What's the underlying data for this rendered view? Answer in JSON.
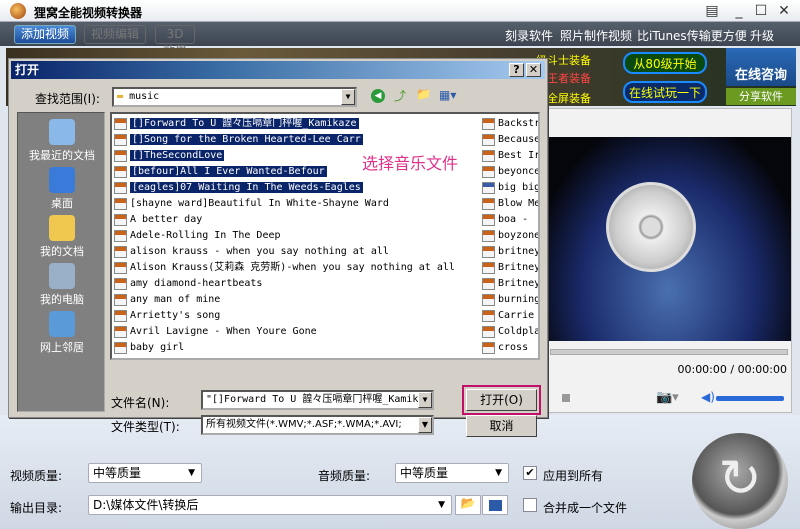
{
  "window": {
    "title": "狸窝全能视频转换器"
  },
  "toolbar": {
    "add_video": "添加视频",
    "edit_video": "视频编辑",
    "effect_3d": "3D效果",
    "links": [
      "刻录软件",
      "照片制作视频",
      "比iTunes传输更方便",
      "升级"
    ]
  },
  "banner": {
    "ads": [
      "级斗士装备",
      "级王者装备",
      "级全屏装备",
      "从80级开始",
      "在线试玩一下"
    ],
    "consult": "在线咨询",
    "share": "分享软件"
  },
  "player": {
    "time": "00:00:00 / 00:00:00",
    "volume_percent": 100
  },
  "dialog": {
    "title": "打开",
    "look_in_label": "查找范围(I):",
    "look_in_value": "music",
    "places": [
      "我最近的文档",
      "桌面",
      "我的文档",
      "我的电脑",
      "网上邻居"
    ],
    "annotation": "选择音乐文件",
    "files_left": [
      {
        "name": "[]Forward To U 韹々压嗝章冂枰喔_Kamikaze",
        "selected": true,
        "type": "mp3"
      },
      {
        "name": "[]Song for the Broken Hearted-Lee Carr",
        "selected": true,
        "type": "mp3"
      },
      {
        "name": "[]TheSecondLove",
        "selected": true,
        "type": "mp3"
      },
      {
        "name": "[befour]All I Ever Wanted-Befour",
        "selected": true,
        "type": "mp3"
      },
      {
        "name": "[eagles]07 Waiting In The Weeds-Eagles",
        "selected": true,
        "type": "mp3"
      },
      {
        "name": "[shayne ward]Beautiful In White-Shayne Ward",
        "selected": false,
        "type": "mp3"
      },
      {
        "name": "A better day",
        "selected": false,
        "type": "mp3"
      },
      {
        "name": "Adele-Rolling In The Deep",
        "selected": false,
        "type": "mp3"
      },
      {
        "name": "alison krauss - when you say nothing at all",
        "selected": false,
        "type": "mp3"
      },
      {
        "name": "Alison Krauss(艾莉森 克劳斯)-when you say nothing at all",
        "selected": false,
        "type": "mp3"
      },
      {
        "name": "amy diamond-heartbeats",
        "selected": false,
        "type": "mp3"
      },
      {
        "name": "any man of mine",
        "selected": false,
        "type": "mp3"
      },
      {
        "name": "Arrietty's song",
        "selected": false,
        "type": "mp3"
      },
      {
        "name": "Avril Lavigne - When Youre Gone",
        "selected": false,
        "type": "mp3"
      },
      {
        "name": "baby girl",
        "selected": false,
        "type": "mp3"
      }
    ],
    "files_right": [
      {
        "name": "Backstr",
        "type": "mp3"
      },
      {
        "name": "Because",
        "type": "mp3"
      },
      {
        "name": "Best Ir",
        "type": "mp3"
      },
      {
        "name": "beyonce",
        "type": "mp3"
      },
      {
        "name": "big big",
        "type": "wma"
      },
      {
        "name": "Blow Me",
        "type": "mp3"
      },
      {
        "name": "boa - ",
        "type": "mp3"
      },
      {
        "name": "boyzone",
        "type": "mp3"
      },
      {
        "name": "britney",
        "type": "mp3"
      },
      {
        "name": "Britney",
        "type": "mp3"
      },
      {
        "name": "Britney",
        "type": "mp3"
      },
      {
        "name": "burning",
        "type": "mp3"
      },
      {
        "name": "Carrie",
        "type": "mp3"
      },
      {
        "name": "Coldpla",
        "type": "mp3"
      },
      {
        "name": "cross",
        "type": "mp3"
      }
    ],
    "filename_label": "文件名(N):",
    "filename_value": "\"[]Forward To U 韹々压嗝章冂枰喔_Kamik",
    "filetype_label": "文件类型(T):",
    "filetype_value": "所有视频文件(*.WMV;*.ASF;*.WMA;*.AVI;",
    "open_button": "打开(O)",
    "cancel_button": "取消"
  },
  "settings": {
    "video_quality_label": "视频质量:",
    "video_quality": "中等质量",
    "audio_quality_label": "音频质量:",
    "audio_quality": "中等质量",
    "apply_all": "应用到所有",
    "apply_all_checked": true,
    "output_label": "输出目录:",
    "output_path": "D:\\媒体文件\\转换后",
    "merge": "合并成一个文件",
    "merge_checked": false
  },
  "colors": {
    "highlight": "#0a246a",
    "annotation": "#e0308a",
    "open_button_frame": "#c0106a"
  }
}
